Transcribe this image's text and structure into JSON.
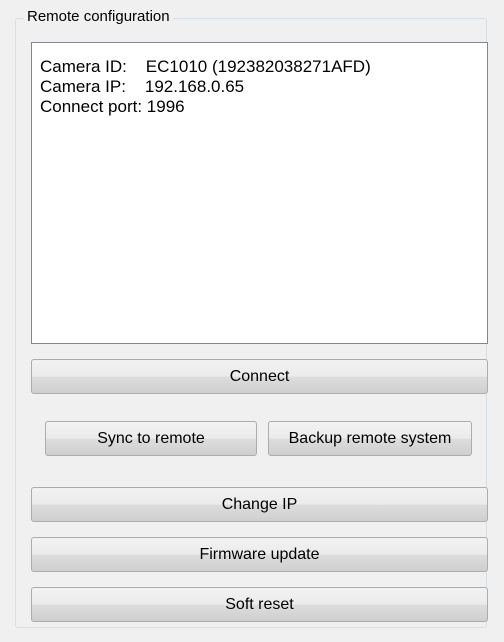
{
  "group": {
    "title": "Remote configuration"
  },
  "info": {
    "lines": [
      "Camera ID:    EC1010 (192382038271AFD)",
      "Camera IP:    192.168.0.65",
      "Connect port: 1996"
    ]
  },
  "buttons": {
    "connect": "Connect",
    "sync": "Sync to remote",
    "backup": "Backup remote system",
    "change_ip": "Change IP",
    "firmware": "Firmware update",
    "soft_reset": "Soft reset"
  }
}
